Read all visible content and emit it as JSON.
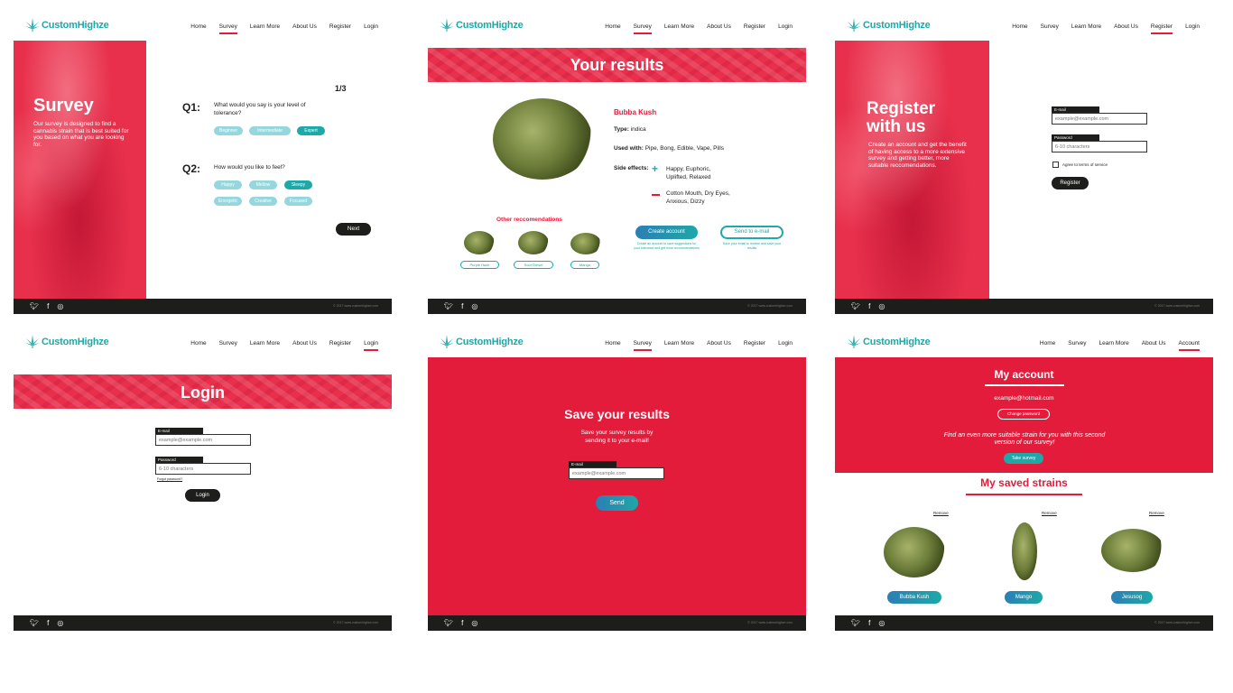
{
  "brand": "CustomHighze",
  "nav": {
    "home": "Home",
    "survey": "Survey",
    "learn_more": "Learn More",
    "about": "About Us",
    "register": "Register",
    "login": "Login",
    "account": "Account"
  },
  "footer": {
    "copy": "© 2017 www.customhighze.com"
  },
  "survey": {
    "title": "Survey",
    "description": "Our survey is designed to find a cannabis strain that is best suited for you based on what you are looking for.",
    "progress": "1/3",
    "q1": {
      "num": "Q1:",
      "text": "What would you say is your level of tolerance?",
      "options": [
        "Beginner",
        "Intermediate",
        "Expert"
      ]
    },
    "q2": {
      "num": "Q2:",
      "text": "How would you like to feel?",
      "options": [
        "Happy",
        "Mellow",
        "Sleepy",
        "Energetic",
        "Creative",
        "Focused"
      ]
    },
    "next": "Next"
  },
  "results": {
    "title": "Your results",
    "strain": "Bubba Kush",
    "type_label": "Type:",
    "type_value": "indica",
    "used_label": "Used with:",
    "used_value": "Pipe, Bong, Edible, Vape, Pills",
    "side_label": "Side effects:",
    "positive": "Happy, Euphoric, Uplifted, Relaxed",
    "negative": "Cotton Mouth, Dry Eyes, Anxious, Dizzy",
    "other_title": "Other reccomendations",
    "others": [
      "Purple Haze",
      "Sour Diesel",
      "Mango"
    ],
    "create_btn": "Create account",
    "create_note": "Create an account to save suggestions for your tolerance and get more recommendations",
    "send_btn": "Send to e-mail",
    "send_note": "Save your email to receive and save your results"
  },
  "register": {
    "title": "Register with us",
    "description": "Create an account and get the benefit of having access to a more extensive survey and getting better, more suitable reccomendations.",
    "email_label": "E-mail",
    "email_placeholder": "example@example.com",
    "password_label": "Password",
    "password_placeholder": "6-10 characters",
    "terms": "Agree to terms of service",
    "button": "Register"
  },
  "login": {
    "title": "Login",
    "email_label": "E-mail",
    "email_placeholder": "example@example.com",
    "password_label": "Password",
    "password_placeholder": "6-10 characters",
    "forgot": "Forgot password?",
    "button": "Login"
  },
  "save": {
    "title": "Save your results",
    "description": "Save your survey results by sending it to your e-mail!",
    "email_label": "E-mail",
    "email_placeholder": "example@example.com",
    "button": "Send"
  },
  "account": {
    "title": "My account",
    "email": "example@hotmail.com",
    "change_pw": "Change password",
    "promo": "Find an even more suitable strain for you with this second version of our survey!",
    "take_survey": "Take survey",
    "saved_title": "My saved strains",
    "remove": "Remove",
    "strains": [
      "Bubba Kush",
      "Mango",
      "Jesusog"
    ]
  },
  "colors": {
    "accent": "#e31c3b",
    "teal": "#1ea8a8",
    "dark": "#1d1d1b"
  }
}
